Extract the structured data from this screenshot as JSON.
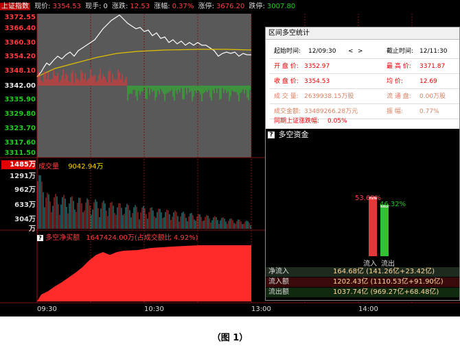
{
  "header": {
    "index_name": "上证指数",
    "current_label": "现价:",
    "current_value": "3354.53",
    "volume_label": "现手:",
    "volume_value": "0",
    "change_label": "涨跌:",
    "change_value": "12.53",
    "pct_label": "涨幅:",
    "pct_value": "0.37%",
    "limit_up_label": "涨停:",
    "limit_up_value": "3676.20",
    "limit_down_label": "跌停:",
    "limit_down_value": "3007.80"
  },
  "price_axis": {
    "red_ticks": [
      "3372.55",
      "3366.40",
      "3360.30",
      "3354.20",
      "3348.10"
    ],
    "base_tick": "3342.00",
    "green_ticks": [
      "3335.90",
      "3329.80",
      "3323.70",
      "3317.60",
      "3311.50"
    ]
  },
  "volume_axis": {
    "badge": "1485万",
    "title": "成交量",
    "value": "9042.94万",
    "ticks": [
      "1291万",
      "962万",
      "633万",
      "304万",
      "万"
    ]
  },
  "net_buy": {
    "title": "多空净买额",
    "value": "1647424.00万(占成交额比 4.92%)"
  },
  "time_axis": [
    "09:30",
    "10:30",
    "13:00",
    "14:00"
  ],
  "stats_panel": {
    "title": "区间多空统计",
    "start_label": "起始时间:",
    "start_value": "12/09:30",
    "nav_prev": "<",
    "nav_next": ">",
    "end_label": "截止时间:",
    "end_value": "12/11:30",
    "open_label": "开 盘 价:",
    "open_value": "3352.97",
    "high_label": "最 高 价:",
    "high_value": "3371.87",
    "close_label": "收 盘 价:",
    "close_value": "3354.53",
    "avg_label": "均    价:",
    "avg_value": "12.69",
    "vol_label": "成 交 量:",
    "vol_value": "2639938.15万股",
    "float_label": "流 通 盘:",
    "float_value": "0.00万股",
    "amount_label": "成交金额:",
    "amount_value": "33489266.28万元",
    "amp_label": "振    幅:",
    "amp_value": "0.77%",
    "period_label": "同期上证涨跌幅:",
    "period_value": "0.05%"
  },
  "capital_panel": {
    "title": "多空资金",
    "icon": "question-icon",
    "inflow_pct": "53.68%",
    "outflow_pct": "46.32%",
    "inflow_label": "流入",
    "outflow_label": "流出",
    "inflow_share": 0.5368,
    "outflow_share": 0.4632,
    "rows": [
      {
        "label": "净流入",
        "value": "164.68亿 (141.26亿+23.42亿)"
      },
      {
        "label": "流入额",
        "value": "1202.43亿 (1110.53亿+91.90亿)"
      },
      {
        "label": "流出额",
        "value": "1037.74亿 (969.27亿+68.48亿)"
      }
    ]
  },
  "caption": "（图 1）",
  "colors": {
    "up": "#ff3333",
    "down": "#22cc22",
    "avg_line": "#e0c000",
    "price_line": "#ffffff",
    "volume_bar": "#3aa0a0",
    "net_fill": "#ff2a2a",
    "grid": "#7a1010",
    "panel_gray": "#595959"
  }
}
